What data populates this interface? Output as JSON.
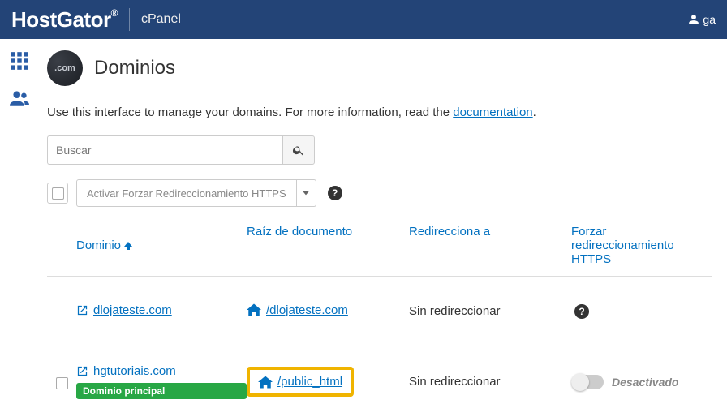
{
  "header": {
    "brand": "HostGator",
    "panel_label": "cPanel",
    "user_prefix": "ga"
  },
  "page": {
    "circle_label": ".com",
    "title": "Dominios",
    "intro_prefix": "Use this interface to manage your domains. For more information, read the ",
    "doc_link": "documentation",
    "intro_suffix": "."
  },
  "search": {
    "placeholder": "Buscar"
  },
  "actions": {
    "https_button": "Activar Forzar Redireccionamiento HTTPS"
  },
  "columns": {
    "domain": "Dominio",
    "doc_root": "Raíz de documento",
    "redirect": "Redirecciona a",
    "force_https": "Forzar redireccionamiento HTTPS"
  },
  "rows": [
    {
      "domain": "dlojateste.com",
      "doc_root": "/dlojateste.com",
      "redirect": "Sin redireccionar",
      "is_main": false,
      "force_https_mode": "help",
      "force_label": ""
    },
    {
      "domain": "hgtutoriais.com",
      "doc_root": "/public_html",
      "redirect": "Sin redireccionar",
      "is_main": true,
      "main_badge": "Dominio principal",
      "force_https_mode": "toggle",
      "force_label": "Desactivado"
    }
  ]
}
